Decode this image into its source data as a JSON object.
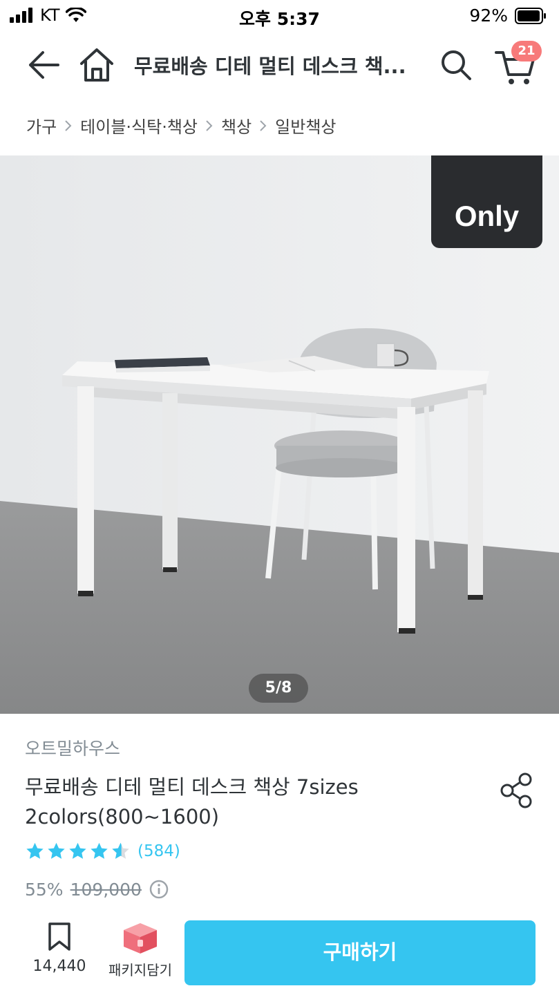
{
  "status_bar": {
    "carrier": "KT",
    "time": "오후 5:37",
    "battery": "92%"
  },
  "nav": {
    "title": "무료배송 디테 멀티 데스크 책...",
    "cart_count": "21",
    "icons": [
      "back-arrow-icon",
      "home-icon",
      "search-icon",
      "cart-icon"
    ]
  },
  "breadcrumb": [
    "가구",
    "테이블·식탁·책상",
    "책상",
    "일반책상"
  ],
  "hero": {
    "badge": "Only",
    "page_indicator": "5/8"
  },
  "product": {
    "brand": "오트밀하우스",
    "title": "무료배송 디테 멀티 데스크 책상 7sizes 2colors(800~1600)",
    "rating": 4.5,
    "review_count": "(584)",
    "discount": "55%",
    "original_price": "109,000",
    "accent_color": "#35c5f0"
  },
  "bottom_bar": {
    "bookmark_count": "14,440",
    "package_label": "패키지담기",
    "buy_label": "구매하기"
  }
}
